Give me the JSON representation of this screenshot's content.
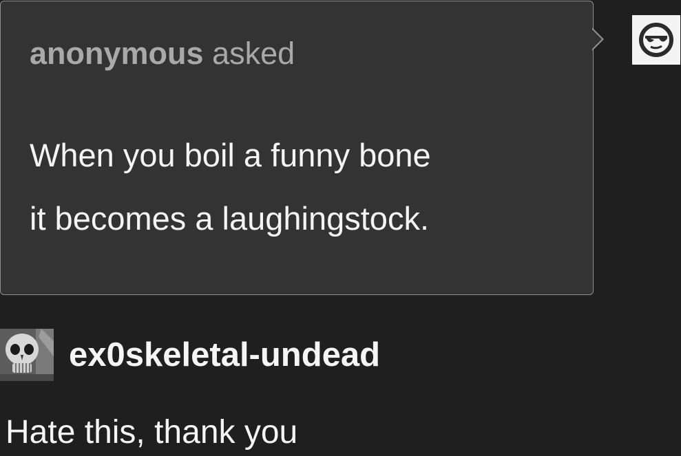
{
  "ask": {
    "asker_name": "anonymous",
    "asked_label": "asked",
    "question_line_1": "When you boil a funny bone",
    "question_line_2": "it becomes a laughingstock."
  },
  "asker_avatar": {
    "icon": "sunglasses-face-icon"
  },
  "reply": {
    "avatar_icon": "skull-avatar",
    "username": "ex0skeletal-undead",
    "text": "Hate this, thank you"
  },
  "colors": {
    "background": "#1f1f1f",
    "bubble": "#333333",
    "bubble_border": "#8f8f8f",
    "muted_text": "#a9a9a9",
    "text": "#f4f4f4"
  }
}
